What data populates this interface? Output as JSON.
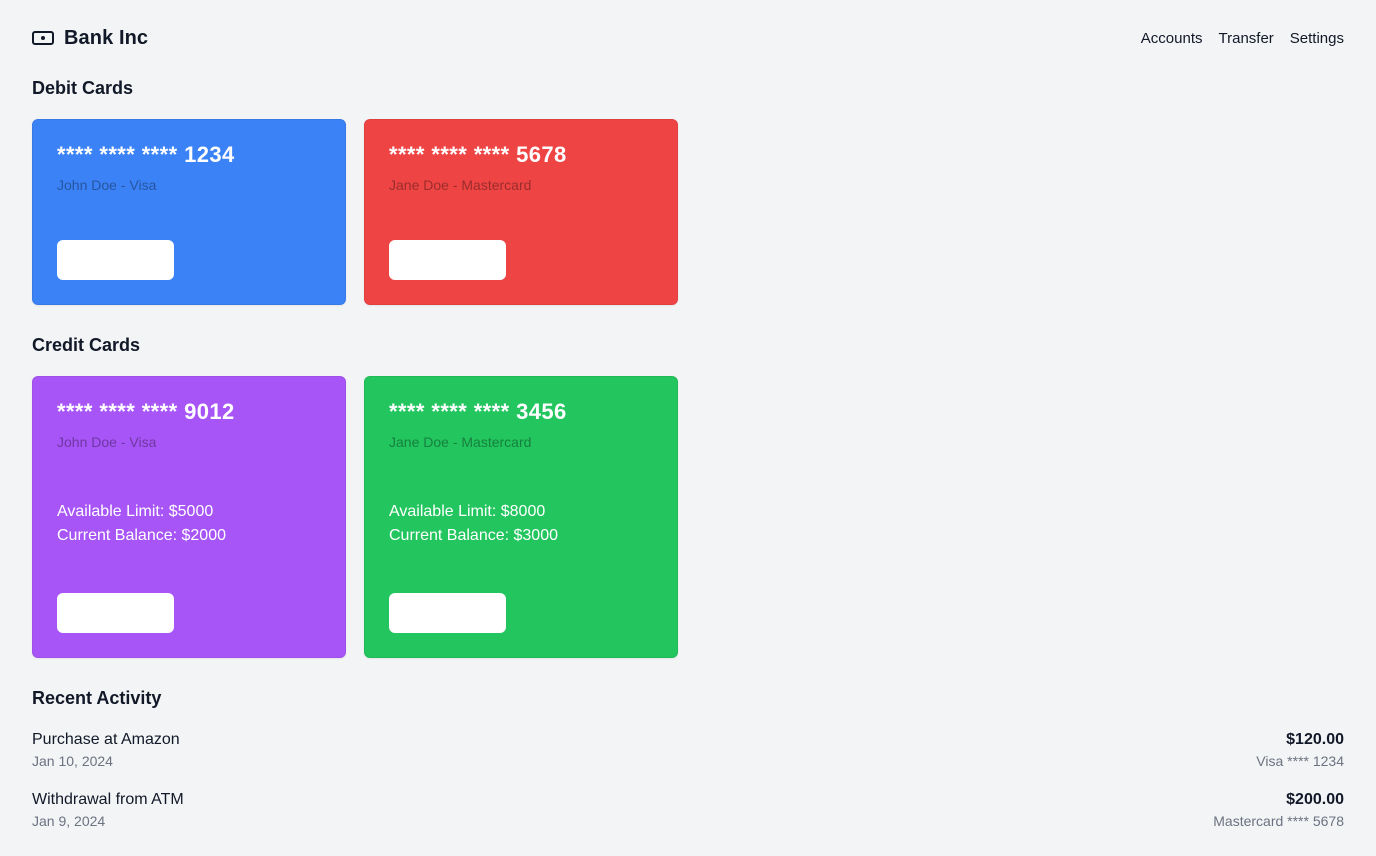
{
  "brand": {
    "name": "Bank Inc",
    "icon": "cash-icon"
  },
  "nav": {
    "accounts": "Accounts",
    "transfer": "Transfer",
    "settings": "Settings"
  },
  "debit": {
    "title": "Debit Cards",
    "cards": [
      {
        "number": "**** **** **** 1234",
        "holder": "John Doe - Visa",
        "color": "#3b82f6"
      },
      {
        "number": "**** **** **** 5678",
        "holder": "Jane Doe - Mastercard",
        "color": "#ef4444"
      }
    ]
  },
  "credit": {
    "title": "Credit Cards",
    "cards": [
      {
        "number": "**** **** **** 9012",
        "holder": "John Doe - Visa",
        "limit": "Available Limit: $5000",
        "balance": "Current Balance: $2000",
        "color": "#a855f7"
      },
      {
        "number": "**** **** **** 3456",
        "holder": "Jane Doe - Mastercard",
        "limit": "Available Limit: $8000",
        "balance": "Current Balance: $3000",
        "color": "#22c55e"
      }
    ]
  },
  "activity": {
    "title": "Recent Activity",
    "items": [
      {
        "title": "Purchase at Amazon",
        "date": "Jan 10, 2024",
        "amount": "$120.00",
        "card": "Visa **** 1234"
      },
      {
        "title": "Withdrawal from ATM",
        "date": "Jan 9, 2024",
        "amount": "$200.00",
        "card": "Mastercard **** 5678"
      }
    ]
  }
}
